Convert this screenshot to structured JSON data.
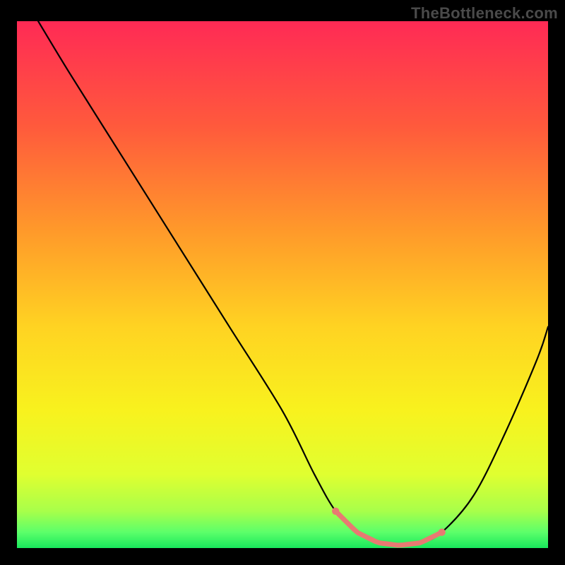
{
  "watermark": "TheBottleneck.com",
  "chart_data": {
    "type": "line",
    "title": "",
    "xlabel": "",
    "ylabel": "",
    "xlim": [
      0,
      100
    ],
    "ylim": [
      0,
      100
    ],
    "grid": false,
    "legend": false,
    "series": [
      {
        "name": "curve",
        "x": [
          4,
          10,
          20,
          30,
          40,
          50,
          56,
          60,
          64,
          68,
          72,
          76,
          80,
          86,
          92,
          98,
          100
        ],
        "y": [
          100,
          90,
          74,
          58,
          42,
          26,
          14,
          7,
          3,
          1,
          0.5,
          1,
          3,
          10,
          22,
          36,
          42
        ]
      }
    ],
    "highlight": {
      "name": "optimal-band",
      "x_range": [
        60,
        80
      ],
      "color": "#e87a72"
    },
    "background_gradient": {
      "stops": [
        {
          "offset": 0.0,
          "color": "#ff2a55"
        },
        {
          "offset": 0.2,
          "color": "#ff5a3c"
        },
        {
          "offset": 0.4,
          "color": "#ff9a2a"
        },
        {
          "offset": 0.58,
          "color": "#ffd322"
        },
        {
          "offset": 0.74,
          "color": "#f8f21e"
        },
        {
          "offset": 0.86,
          "color": "#e0ff30"
        },
        {
          "offset": 0.93,
          "color": "#a8ff4a"
        },
        {
          "offset": 0.97,
          "color": "#5cff6a"
        },
        {
          "offset": 1.0,
          "color": "#18e85c"
        }
      ]
    }
  }
}
